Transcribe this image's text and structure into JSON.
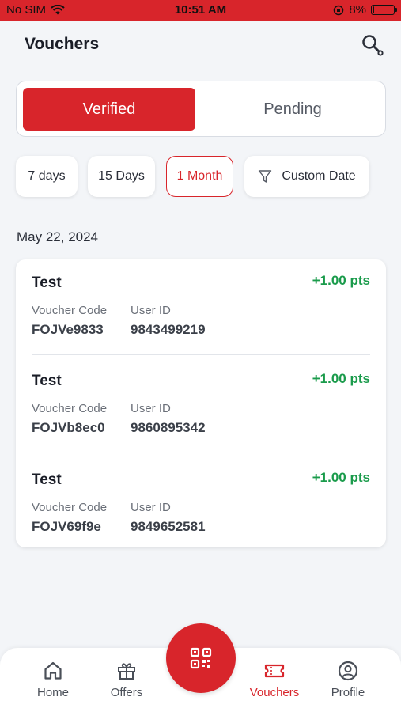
{
  "status_bar": {
    "carrier": "No SIM",
    "time": "10:51 AM",
    "battery": "8%",
    "battery_level": 0.08
  },
  "header": {
    "title": "Vouchers"
  },
  "tabs": [
    {
      "label": "Verified",
      "active": true
    },
    {
      "label": "Pending",
      "active": false
    }
  ],
  "filters": [
    {
      "label": "7 days",
      "active": false
    },
    {
      "label": "15 Days",
      "active": false
    },
    {
      "label": "1 Month",
      "active": true
    },
    {
      "label": "Custom Date",
      "active": false
    }
  ],
  "date_heading": "May 22, 2024",
  "vouchers": [
    {
      "title": "Test",
      "points": "+1.00 pts",
      "code_label": "Voucher Code",
      "code": "FOJVe9833",
      "user_label": "User ID",
      "user_id": "9843499219"
    },
    {
      "title": "Test",
      "points": "+1.00 pts",
      "code_label": "Voucher Code",
      "code": "FOJVb8ec0",
      "user_label": "User ID",
      "user_id": "9860895342"
    },
    {
      "title": "Test",
      "points": "+1.00 pts",
      "code_label": "Voucher Code",
      "code": "FOJV69f9e",
      "user_label": "User ID",
      "user_id": "9849652581"
    }
  ],
  "nav": {
    "home": "Home",
    "offers": "Offers",
    "vouchers": "Vouchers",
    "profile": "Profile"
  },
  "colors": {
    "accent": "#d8252b",
    "points": "#1a9b4b",
    "background": "#f3f5f8"
  }
}
